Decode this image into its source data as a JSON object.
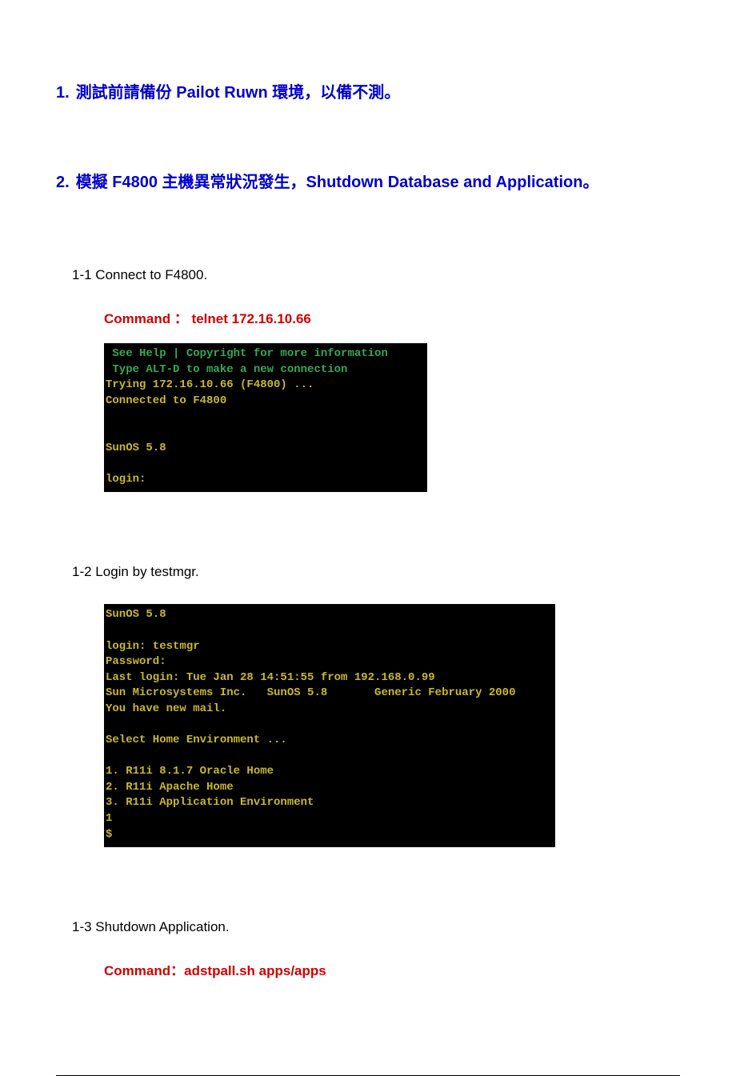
{
  "heading1": {
    "num": "1.",
    "text": "測試前請備份 Pailot Ruwn  環境，以備不測。"
  },
  "heading2": {
    "num": "2.",
    "text": "模擬 F4800 主機異常狀況發生，Shutdown Database and Application。"
  },
  "section1": {
    "label": "1-1  Connect to F4800.",
    "command": "Command ：  telnet 172.16.10.66",
    "term_lines": [
      {
        "cls": "green",
        "text": " See Help | Copyright for more information"
      },
      {
        "cls": "green",
        "text": " Type ALT-D to make a new connection"
      },
      {
        "cls": "amber",
        "text": "Trying 172.16.10.66 (F4800) ..."
      },
      {
        "cls": "amber",
        "text": "Connected to F4800"
      },
      {
        "cls": "amber",
        "text": ""
      },
      {
        "cls": "amber",
        "text": ""
      },
      {
        "cls": "amber",
        "text": "SunOS 5.8"
      },
      {
        "cls": "amber",
        "text": ""
      },
      {
        "cls": "amber",
        "text": "login:"
      }
    ]
  },
  "section2": {
    "label": "1-2  Login by testmgr.",
    "term_lines": [
      {
        "cls": "amber",
        "text": "SunOS 5.8"
      },
      {
        "cls": "amber",
        "text": ""
      },
      {
        "cls": "amber",
        "text": "login: testmgr"
      },
      {
        "cls": "amber",
        "text": "Password:"
      },
      {
        "cls": "amber",
        "text": "Last login: Tue Jan 28 14:51:55 from 192.168.0.99"
      },
      {
        "cls": "amber",
        "text": "Sun Microsystems Inc.   SunOS 5.8       Generic February 2000"
      },
      {
        "cls": "amber",
        "text": "You have new mail."
      },
      {
        "cls": "amber",
        "text": ""
      },
      {
        "cls": "amber",
        "text": "Select Home Environment ..."
      },
      {
        "cls": "amber",
        "text": ""
      },
      {
        "cls": "amber",
        "text": "1. R11i 8.1.7 Oracle Home"
      },
      {
        "cls": "amber",
        "text": "2. R11i Apache Home"
      },
      {
        "cls": "amber",
        "text": "3. R11i Application Environment"
      },
      {
        "cls": "amber",
        "text": "1"
      },
      {
        "cls": "amber",
        "text": "$"
      }
    ]
  },
  "section3": {
    "label": "1-3  Shutdown Application.",
    "command": "Command：adstpall.sh apps/apps"
  }
}
